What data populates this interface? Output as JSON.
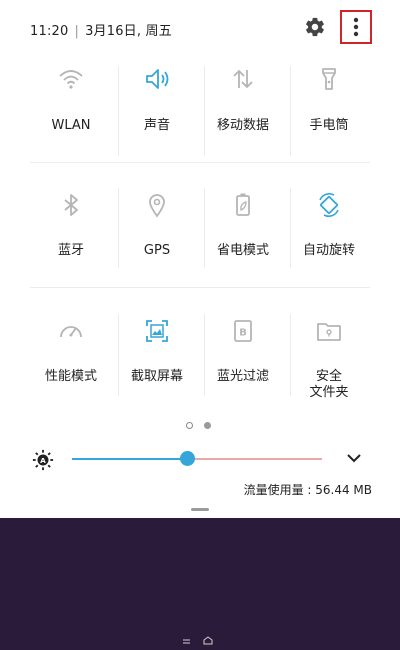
{
  "status_bar": {
    "time": "11:20",
    "date": "3月16日, 周五"
  },
  "tiles": [
    {
      "label": "WLAN",
      "icon": "wifi-icon",
      "active": false
    },
    {
      "label": "声音",
      "icon": "sound-icon",
      "active": true
    },
    {
      "label": "移动数据",
      "icon": "mobile-data-icon",
      "active": false
    },
    {
      "label": "手电筒",
      "icon": "flashlight-icon",
      "active": false
    },
    {
      "label": "蓝牙",
      "icon": "bluetooth-icon",
      "active": false
    },
    {
      "label": "GPS",
      "icon": "location-icon",
      "active": false
    },
    {
      "label": "省电模式",
      "icon": "power-saving-icon",
      "active": false
    },
    {
      "label": "自动旋转",
      "icon": "auto-rotate-icon",
      "active": true
    },
    {
      "label": "性能模式",
      "icon": "performance-icon",
      "active": false
    },
    {
      "label": "截取屏幕",
      "icon": "screenshot-icon",
      "active": true
    },
    {
      "label": "蓝光过滤",
      "icon": "blue-light-filter-icon",
      "active": false
    },
    {
      "label": "安全\n文件夹",
      "icon": "secure-folder-icon",
      "active": false
    }
  ],
  "page_indicator": {
    "current": 1,
    "total": 2
  },
  "brightness": {
    "level": 0.46
  },
  "data_usage": "流量使用量 : 56.44 MB",
  "colors": {
    "accent": "#36a6d8",
    "inactive_icon": "#9a9a9a",
    "highlight_box": "#d0232a",
    "wallpaper": "#2b1b3a"
  }
}
